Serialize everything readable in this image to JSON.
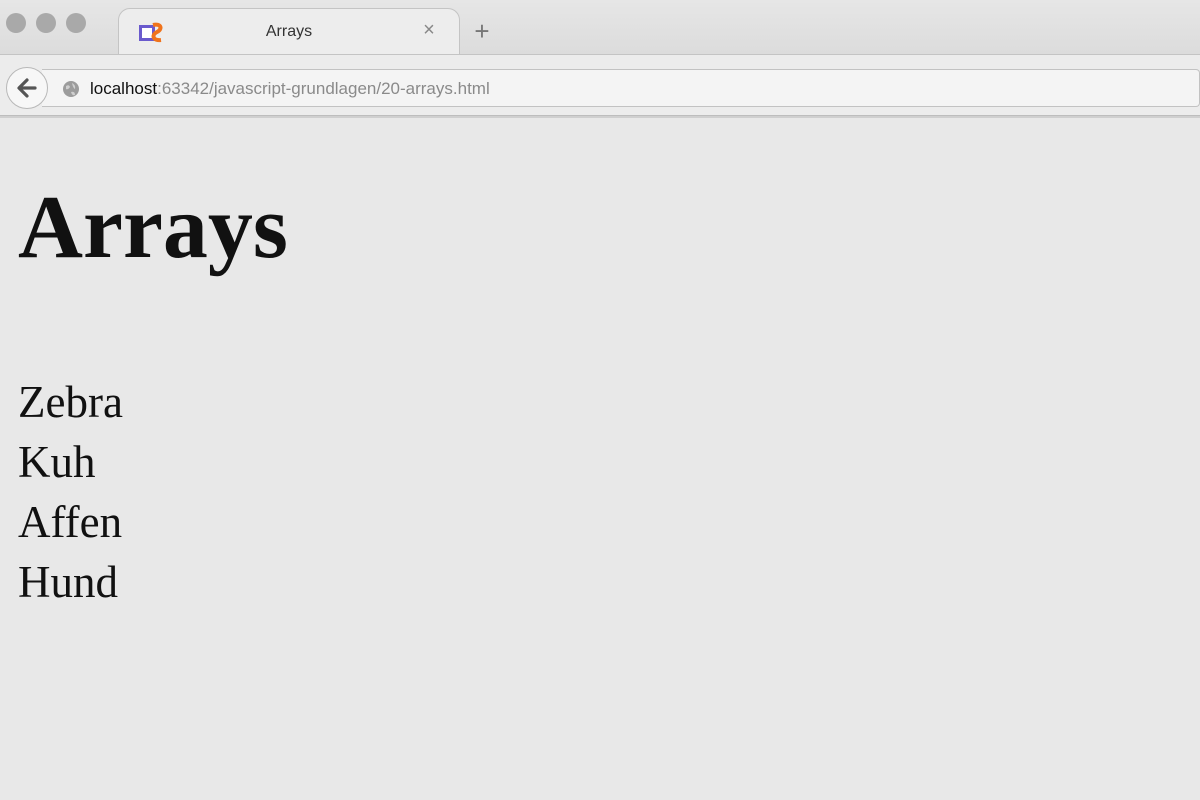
{
  "browser": {
    "tab": {
      "title": "Arrays",
      "close_glyph": "×",
      "favicon": "phpstorm-icon"
    },
    "new_tab_glyph": "+",
    "address": {
      "host": "localhost",
      "rest": ":63342/javascript-grundlagen/20-arrays.html"
    }
  },
  "page": {
    "heading": "Arrays",
    "items": [
      "Zebra",
      "Kuh",
      "Affen",
      "Hund"
    ]
  }
}
